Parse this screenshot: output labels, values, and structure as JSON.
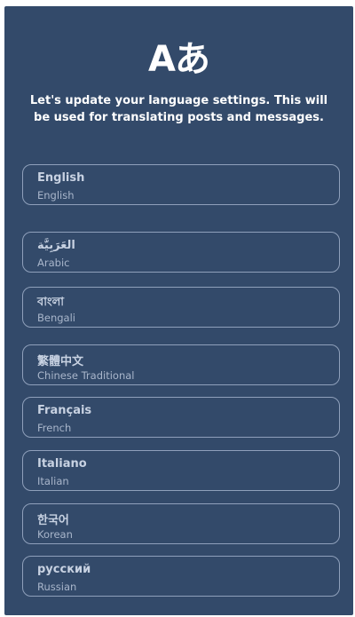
{
  "header": {
    "icon_text": "Aあ",
    "intro": "Let's update your language settings. This will be used for translating posts and messages."
  },
  "languages": [
    {
      "native": "English",
      "english": "English"
    },
    {
      "native": "العَرَبِيَّة",
      "english": "Arabic"
    },
    {
      "native": "বাংলা",
      "english": "Bengali"
    },
    {
      "native": "繁體中文",
      "english": "Chinese Traditional"
    },
    {
      "native": "Français",
      "english": "French"
    },
    {
      "native": "Italiano",
      "english": "Italian"
    },
    {
      "native": "한국어",
      "english": "Korean"
    },
    {
      "native": "русский",
      "english": "Russian"
    }
  ],
  "colors": {
    "panel_background": "#334a6a",
    "option_border": "#8fa0bb"
  }
}
